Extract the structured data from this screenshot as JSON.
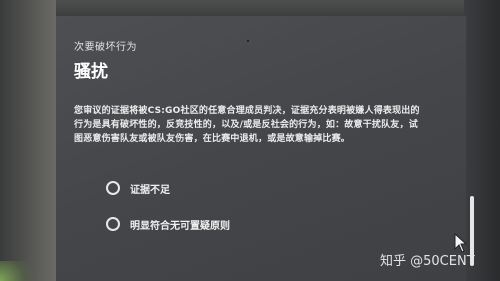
{
  "dialog": {
    "subtitle": "次要破坏行为",
    "title": "骚扰",
    "description": "您审议的证据将被CS:GO社区的任意合理成员判决，证据充分表明被嫌人得表现出的行为是具有破坏性的，反竞技性的，以及/或是反社会的行为，如：故意干扰队友，试图恶意伤害队友或被队友伤害，在比赛中退机，或是故意输掉比赛。",
    "options": [
      {
        "label": "证据不足",
        "selected": false
      },
      {
        "label": "明显符合无可置疑原则",
        "selected": false
      }
    ]
  },
  "watermark": {
    "text": "知乎 @50CENT"
  },
  "icons": {
    "cursor": "mouse-cursor-icon",
    "radio": "radio-button-icon"
  }
}
